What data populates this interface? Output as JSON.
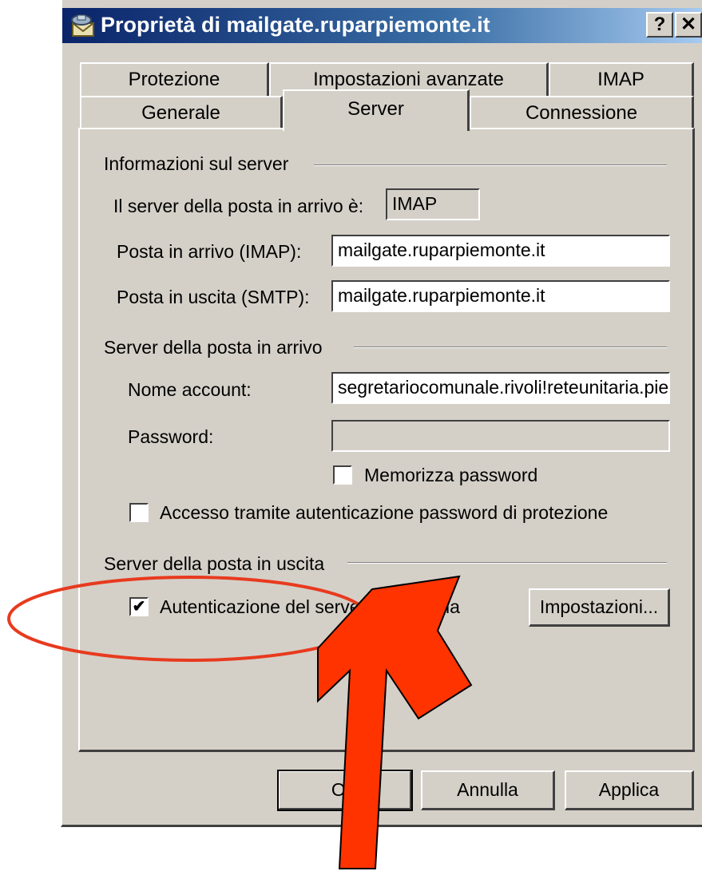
{
  "window": {
    "title": "Proprietà di mailgate.ruparpiemonte.it",
    "help_label": "?",
    "close_label": "✕"
  },
  "tabs": {
    "row_back": [
      {
        "label": "Protezione"
      },
      {
        "label": "Impostazioni avanzate"
      },
      {
        "label": "IMAP"
      }
    ],
    "row_front": [
      {
        "label": "Generale"
      },
      {
        "label": "Server",
        "active": true
      },
      {
        "label": "Connessione"
      }
    ]
  },
  "server_info": {
    "group_label": "Informazioni sul server",
    "incoming_type_label": "Il server della posta in arrivo è:",
    "incoming_type_value": "IMAP",
    "incoming_label": "Posta in arrivo (IMAP):",
    "incoming_value": "mailgate.ruparpiemonte.it",
    "outgoing_label": "Posta in uscita (SMTP):",
    "outgoing_value": "mailgate.ruparpiemonte.it"
  },
  "incoming_server": {
    "group_label": "Server della posta in arrivo",
    "account_label": "Nome account:",
    "account_value": "segretariocomunale.rivoli!reteunitaria.pie",
    "password_label": "Password:",
    "password_value": "",
    "remember_password_label": "Memorizza password",
    "remember_password_checked": false,
    "spa_label": "Accesso tramite autenticazione password di protezione",
    "spa_checked": false
  },
  "outgoing_server": {
    "group_label": "Server della posta in uscita",
    "auth_label": "Autenticazione del server necessaria",
    "auth_checked": true,
    "auth_check_glyph": "✔",
    "settings_button": "Impostazioni..."
  },
  "buttons": {
    "ok": "OK",
    "cancel": "Annulla",
    "apply": "Applica"
  },
  "annotation_colors": {
    "ellipse": "#e83a1e",
    "arrow": "#ff3300"
  }
}
